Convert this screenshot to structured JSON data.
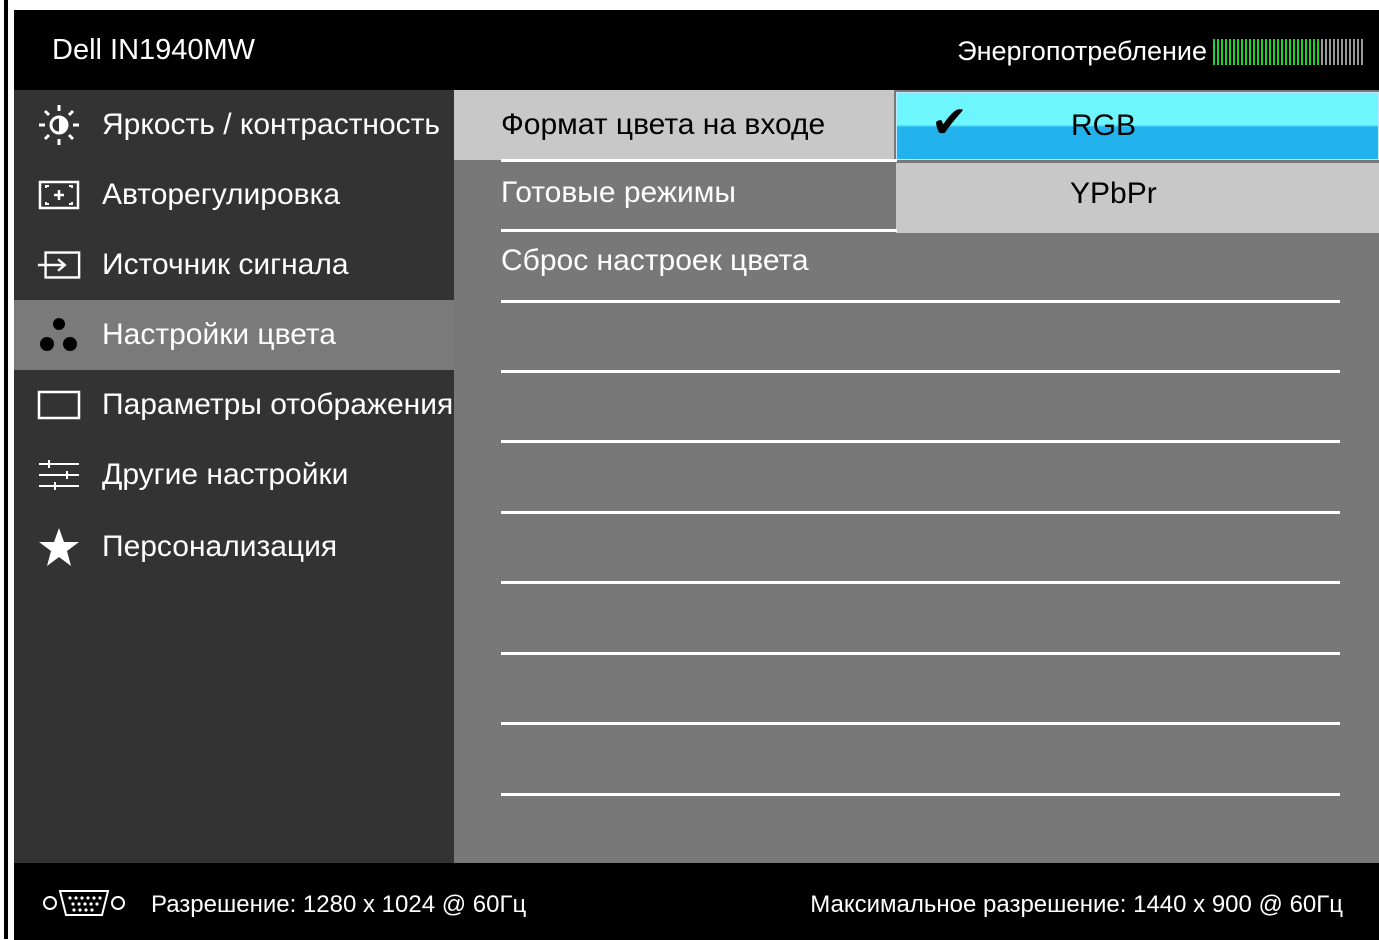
{
  "header": {
    "title": "Dell IN1940MW",
    "energy_label": "Энергопотребление",
    "energy_level": 0.7
  },
  "sidebar": {
    "items": [
      {
        "label": "Яркость / контрастность",
        "icon": "brightness-icon"
      },
      {
        "label": "Авторегулировка",
        "icon": "auto-adjust-icon"
      },
      {
        "label": "Источник сигнала",
        "icon": "input-source-icon"
      },
      {
        "label": "Настройки цвета",
        "icon": "color-settings-icon",
        "active": true
      },
      {
        "label": "Параметры отображения",
        "icon": "display-settings-icon"
      },
      {
        "label": "Другие настройки",
        "icon": "other-settings-icon"
      },
      {
        "label": "Персонализация",
        "icon": "star-icon"
      }
    ]
  },
  "submenu": {
    "items": [
      {
        "label": "Формат цвета на входе",
        "selected": true
      },
      {
        "label": "Готовые режимы"
      },
      {
        "label": "Сброс настроек цвета"
      }
    ]
  },
  "options": {
    "rgb": {
      "label": "RGB",
      "checked": true
    },
    "ypbpr": {
      "label": "YPbPr"
    }
  },
  "footer": {
    "resolution": "Разрешение: 1280 x 1024 @ 60Гц",
    "max_resolution": "Максимальное разрешение: 1440 x 900 @ 60Гц"
  },
  "colors": {
    "accent": "#22b2ee",
    "highlight": "#6ef6ff",
    "energy_on": "#22d22a",
    "energy_off": "#9a9a9a"
  }
}
